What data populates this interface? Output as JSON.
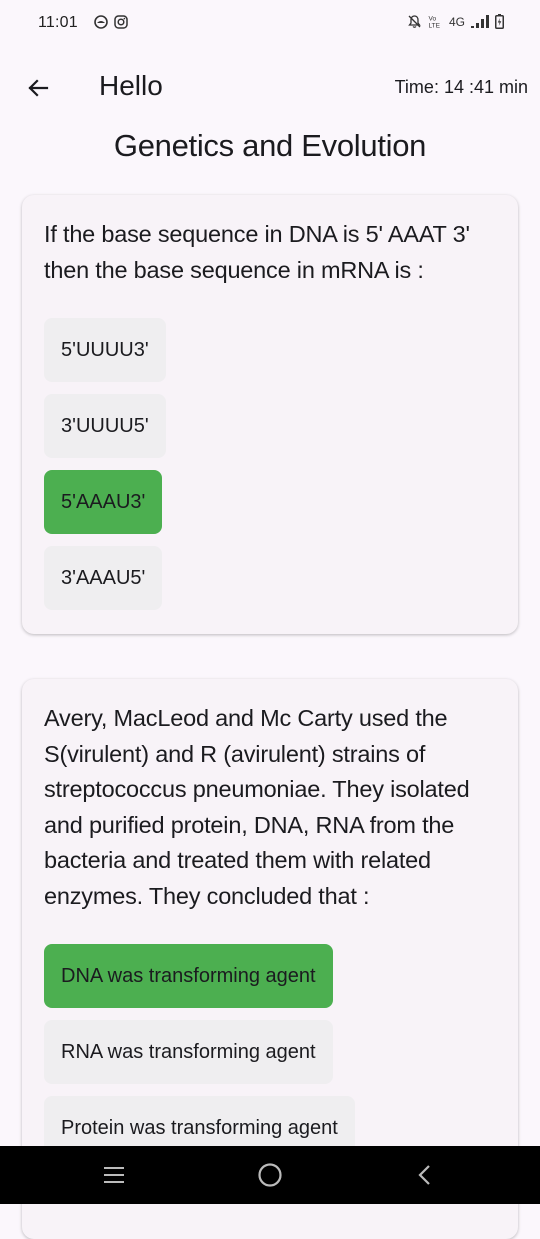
{
  "status_bar": {
    "time": "11:01",
    "network_label": "4G"
  },
  "header": {
    "title": "Hello",
    "timer": "Time: 14 :41 min"
  },
  "page_title": "Genetics and Evolution",
  "questions": [
    {
      "text": "If the base sequence in DNA is 5' AAAT 3' then the base sequence in mRNA is :",
      "options": [
        {
          "label": "5'UUUU3'",
          "selected": false
        },
        {
          "label": "3'UUUU5'",
          "selected": false
        },
        {
          "label": "5'AAAU3'",
          "selected": true
        },
        {
          "label": "3'AAAU5'",
          "selected": false
        }
      ]
    },
    {
      "text": "Avery, MacLeod and Mc Carty used the S(virulent) and R (avirulent) strains of streptococcus pneumoniae. They isolated and purified protein, DNA, RNA from the bacteria and treated them with related enzymes. They concluded that :",
      "options": [
        {
          "label": "DNA was transforming agent",
          "selected": true
        },
        {
          "label": "RNA was transforming agent",
          "selected": false
        },
        {
          "label": "Protein was transforming agent",
          "selected": false
        }
      ]
    }
  ],
  "colors": {
    "background": "#fbf7fc",
    "card": "#f8f3f8",
    "option": "#efeef0",
    "selected_option": "#4caf50",
    "nav_bar": "#000000"
  },
  "icons": {
    "back": "arrow-left-icon",
    "nav_recent": "recent-apps-icon",
    "nav_home": "home-icon",
    "nav_back": "nav-back-icon"
  }
}
